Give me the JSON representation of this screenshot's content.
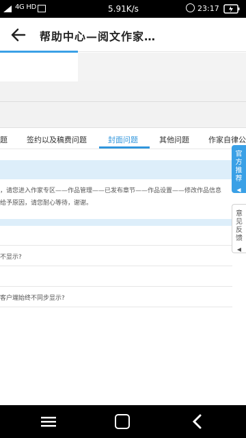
{
  "status_bar": {
    "network": "4G HD",
    "speed": "5.91K/s",
    "time": "23:17"
  },
  "header": {
    "title": "帮助中心—阅文作家…"
  },
  "tabs": [
    {
      "label": "题"
    },
    {
      "label": "签约以及稿费问题"
    },
    {
      "label": "封面问题"
    },
    {
      "label": "其他问题"
    },
    {
      "label": "作家自律公"
    }
  ],
  "active_tab": "封面问题",
  "content": {
    "paragraph_line1": "，请您进入作家专区——作品管理——已发布章节——作品设置——修改作品信息",
    "paragraph_line2": "给予原因，请您耐心等待，谢谢。",
    "question1": "不显示?",
    "question2": "客户端始终不同步显示?"
  },
  "side_tabs": {
    "recommend": "官方推荐",
    "feedback": "意见反馈"
  },
  "colors": {
    "accent": "#2f95dc",
    "light_blue": "#ddeefa",
    "side_tab_blue": "#3aa0e6"
  },
  "icons": {
    "back": "arrow-left-icon",
    "menu": "menu-icon",
    "home": "home-icon",
    "nav_back": "chevron-left-icon"
  }
}
